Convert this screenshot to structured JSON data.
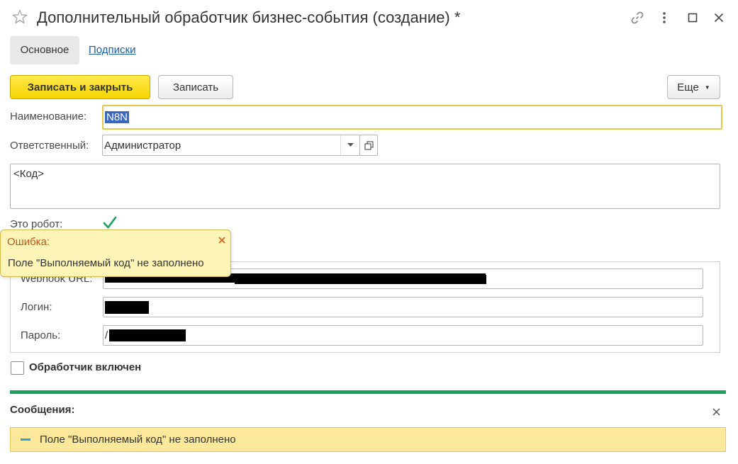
{
  "window": {
    "title": "Дополнительный обработчик бизнес-события (создание) *"
  },
  "tabs": [
    {
      "label": "Основное",
      "active": true
    },
    {
      "label": "Подписки",
      "active": false
    }
  ],
  "toolbar": {
    "save_close_label": "Записать и закрыть",
    "save_label": "Записать",
    "more_label": "Еще"
  },
  "form": {
    "name_label": "Наименование:",
    "name_value": "N8N",
    "responsible_label": "Ответственный:",
    "responsible_value": "Администратор",
    "code_value": "<Код>",
    "robot_label": "Это робот:",
    "robot_checked": true,
    "webhook_label": "Webhook URL:",
    "login_label": "Логин:",
    "password_label": "Пароль:",
    "password_prefix": "/",
    "enabled_label": "Обработчик включен",
    "enabled_checked": false
  },
  "tooltip": {
    "title": "Ошибка:",
    "text": "Поле \"Выполняемый код\" не заполнено"
  },
  "messages": {
    "title": "Сообщения:",
    "items": [
      {
        "text": "Поле \"Выполняемый код\" не заполнено"
      }
    ]
  },
  "colors": {
    "accent_yellow": "#f5d400",
    "focus_border": "#e8c84a",
    "selection": "#3a68bf",
    "link": "#1b5ea8",
    "check_green": "#19a05a",
    "error_text": "#c0571a",
    "message_bg": "#fbe89b",
    "tooltip_bg": "#fdf5b8"
  }
}
